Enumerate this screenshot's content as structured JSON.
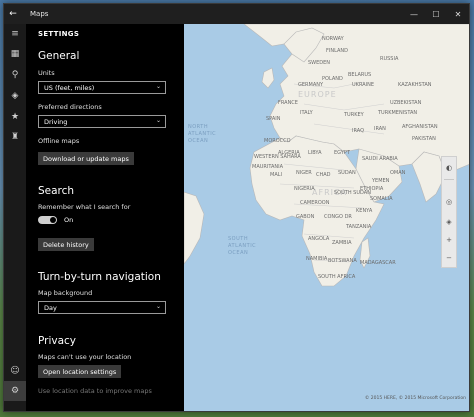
{
  "window": {
    "title": "Maps",
    "back_glyph": "←",
    "minimize_glyph": "—",
    "maximize_glyph": "☐",
    "close_glyph": "✕"
  },
  "rail": {
    "icons": [
      {
        "name": "hamburger-menu-icon",
        "glyph": "≡"
      },
      {
        "name": "map-icon",
        "glyph": "▦"
      },
      {
        "name": "search-icon",
        "glyph": "⚲"
      },
      {
        "name": "directions-icon",
        "glyph": "◈"
      },
      {
        "name": "favorites-icon",
        "glyph": "★"
      },
      {
        "name": "3d-cities-icon",
        "glyph": "♜"
      },
      {
        "name": "account-icon",
        "glyph": "☺"
      },
      {
        "name": "settings-icon",
        "glyph": "⚙"
      }
    ]
  },
  "settings": {
    "header": "SETTINGS",
    "general": {
      "title": "General",
      "units_label": "Units",
      "units_value": "US (feet, miles)",
      "directions_label": "Preferred directions",
      "directions_value": "Driving",
      "offline_label": "Offline maps",
      "offline_button": "Download or update maps"
    },
    "search": {
      "title": "Search",
      "remember_label": "Remember what I search for",
      "toggle_state": "On",
      "delete_button": "Delete history"
    },
    "navigation": {
      "title": "Turn-by-turn navigation",
      "background_label": "Map background",
      "background_value": "Day"
    },
    "privacy": {
      "title": "Privacy",
      "location_label": "Maps can't use your location",
      "location_button": "Open location settings",
      "use_location_label": "Use location data to improve maps"
    }
  },
  "map": {
    "continents": [
      {
        "text": "EUROPE"
      },
      {
        "text": "AFRICA"
      }
    ],
    "oceans": [
      {
        "text": "NORTH ATLANTIC OCEAN"
      },
      {
        "text": "SOUTH ATLANTIC OCEAN"
      }
    ],
    "countries": [
      "NORWAY",
      "FINLAND",
      "SWEDEN",
      "RUSSIA",
      "BELARUS",
      "UKRAINE",
      "KAZAKHSTAN",
      "POLAND",
      "GERMANY",
      "FRANCE",
      "SPAIN",
      "ITALY",
      "TURKEY",
      "UZBEKISTAN",
      "TURKMENISTAN",
      "IRAQ",
      "IRAN",
      "ALGERIA",
      "LIBYA",
      "EGYPT",
      "SAUDI ARABIA",
      "WESTERN SAHARA",
      "MALI",
      "NIGER",
      "SUDAN",
      "CHAD",
      "MAURITANIA",
      "NIGERIA",
      "ETHIOPIA",
      "CONGO DR",
      "KENYA",
      "TANZANIA",
      "ANGOLA",
      "ZAMBIA",
      "NAMIBIA",
      "BOTSWANA",
      "MADAGASCAR",
      "SOUTH AFRICA",
      "MOROCCO",
      "PAKISTAN",
      "AFGHANISTAN",
      "OMAN",
      "YEMEN",
      "SOMALIA",
      "SOUTH SUDAN",
      "CAMEROON",
      "GABON"
    ],
    "copyright": "© 2015 HERE, © 2015 Microsoft Corporation"
  }
}
